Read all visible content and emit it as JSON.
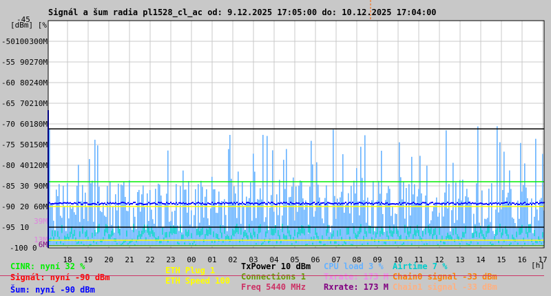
{
  "chart_data": {
    "type": "bar",
    "title": "Signál a šum radia pl1528_cl_ac od: 9.12.2025 17:05:00 do: 10.12.2025 17:04:00",
    "ylabel": "[dBm] [%]",
    "xlabel": "[h]",
    "ylim_dbm": [
      -100,
      -45
    ],
    "y_ticks_dbm": [
      "-45",
      "-50",
      "-55",
      "-60",
      "-65",
      "-70",
      "-75",
      "-80",
      "-85",
      "-90",
      "-95",
      "-100"
    ],
    "y_ticks_pct": [
      "100",
      "90",
      "80",
      "70",
      "60",
      "50",
      "40",
      "30",
      "20",
      "10",
      "0"
    ],
    "y_ticks_rate": [
      "300M",
      "270M",
      "240M",
      "210M",
      "180M",
      "150M",
      "120M",
      "90M",
      "60M"
    ],
    "rate_markers": [
      {
        "label": "39M",
        "color": "#e080e0"
      },
      {
        "label": "13M",
        "color": "#e080e0"
      },
      {
        "label": "6M",
        "color": "#800080"
      }
    ],
    "x_ticks": [
      "18",
      "19",
      "20",
      "21",
      "22",
      "23",
      "00",
      "01",
      "02",
      "03",
      "04",
      "05",
      "06",
      "07",
      "08",
      "09",
      "10",
      "11",
      "12",
      "13",
      "14",
      "15",
      "16",
      "17"
    ],
    "grid": true,
    "series": [
      {
        "name": "CINR",
        "color": "#00ff00",
        "typical_pct": 32
      },
      {
        "name": "Signál",
        "color": "#ff0000",
        "typical_dbm": -90
      },
      {
        "name": "Šum",
        "color": "#0000ff",
        "typical_dbm": -90
      },
      {
        "name": "CPU load",
        "color": "#66b2ff",
        "typical_pct": 3
      },
      {
        "name": "Airtime",
        "color": "#00cccc",
        "typical_pct": 7
      },
      {
        "name": "Rxrate",
        "color": "#800080",
        "typical_mbit": 173
      },
      {
        "name": "Txrate",
        "color": "#e080e0",
        "typical_mbit": 173
      }
    ]
  },
  "legend": {
    "cinr": "CINR: nyní 32 %",
    "signal": "Signál: nyní -90 dBm",
    "noise": "Šum: nyní -90 dBm",
    "eth_plug": "ETH Plug 1",
    "eth_speed": "ETH Speed 100",
    "txpower": "TxPower 10 dBm",
    "connections": "Connections 1",
    "freq": "Freq 5440 MHz",
    "cpu": "CPU load 3 %",
    "txrate": "Txrate: 173 M",
    "rxrate": "Rxrate: 173 M",
    "airtime": "Airtime 7 %",
    "chain0": "Chain0 signal -33 dBm",
    "chain1": "Chain1 signal -33 dBm"
  },
  "colors": {
    "cinr": "#00ee00",
    "signal": "#ff0000",
    "noise": "#0000ff",
    "eth": "#ffff00",
    "txpower": "#000000",
    "connections": "#669900",
    "freq": "#cc3366",
    "cpu": "#66b2ff",
    "txrate": "#ee88ee",
    "rxrate": "#800080",
    "airtime": "#00cccc",
    "chain0": "#ff8000",
    "chain1": "#ffb080"
  }
}
